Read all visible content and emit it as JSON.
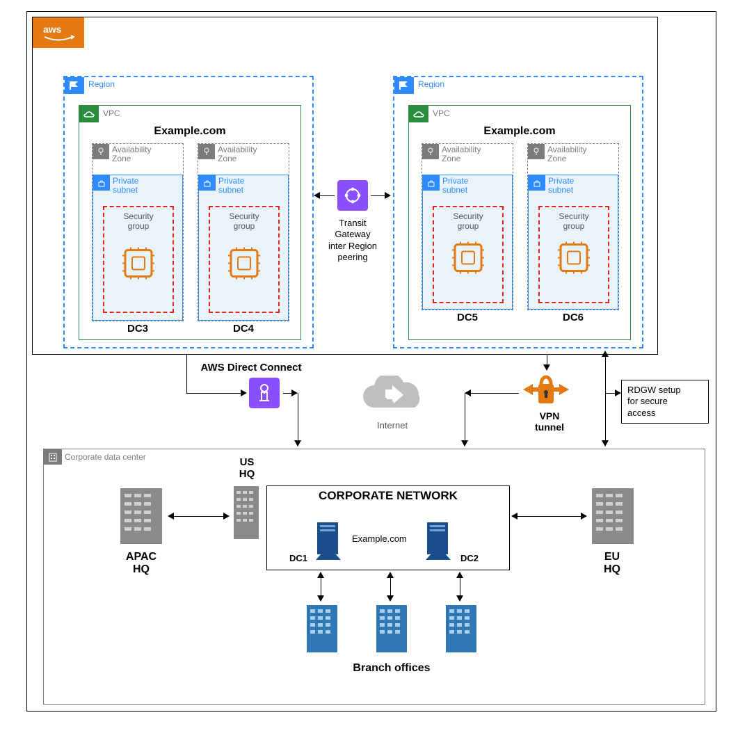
{
  "aws_cloud": {
    "logo_alt": "aws"
  },
  "regions": [
    {
      "label": "Region",
      "vpc": {
        "badge": "VPC",
        "title": "Example.com",
        "azs": [
          {
            "label": "Availability\nZone",
            "subnet_label": "Private\nsubnet",
            "sg_label": "Security\ngroup",
            "dc": "DC3"
          },
          {
            "label": "Availability\nZone",
            "subnet_label": "Private\nsubnet",
            "sg_label": "Security\ngroup",
            "dc": "DC4"
          }
        ]
      }
    },
    {
      "label": "Region",
      "vpc": {
        "badge": "VPC",
        "title": "Example.com",
        "azs": [
          {
            "label": "Availability\nZone",
            "subnet_label": "Private\nsubnet",
            "sg_label": "Security\ngroup",
            "dc": "DC5"
          },
          {
            "label": "Availability\nZone",
            "subnet_label": "Private\nsubnet",
            "sg_label": "Security\ngroup",
            "dc": "DC6"
          }
        ]
      }
    }
  ],
  "transit_gateway": {
    "label": "Transit\nGateway\ninter\nRegion\npeering"
  },
  "connections": {
    "direct_connect": "AWS Direct Connect",
    "internet": "Internet",
    "vpn_tunnel": "VPN\ntunnel",
    "rdgw": "RDGW setup\nfor secure\naccess"
  },
  "corporate": {
    "label": "Corporate data center",
    "hq": {
      "apac": "APAC\nHQ",
      "us": "US\nHQ",
      "eu": "EU\nHQ"
    },
    "corp_net": {
      "title": "CORPORATE NETWORK",
      "domain": "Example.com",
      "dc1": "DC1",
      "dc2": "DC2"
    },
    "branches": "Branch offices"
  }
}
